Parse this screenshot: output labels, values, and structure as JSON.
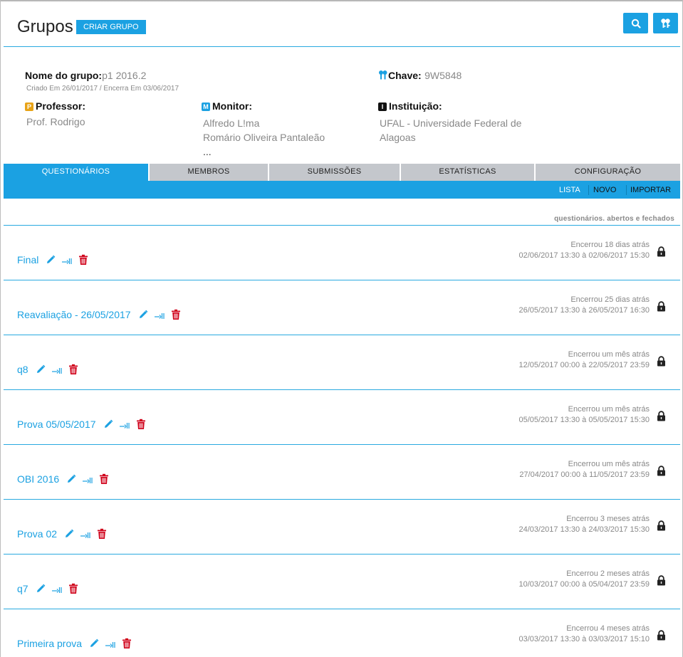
{
  "page": {
    "title": "Grupos",
    "create_button": "CRIAR GRUPO"
  },
  "header_icons": [
    "search-icon",
    "keys-icon"
  ],
  "group": {
    "name_label": "Nome do grupo:",
    "name": "p1 2016.2",
    "dates": "Criado Em 26/01/2017 / Encerra Em 03/06/2017",
    "key_label": "Chave:",
    "key": "9W5848",
    "professor_badge": "P",
    "professor_label": "Professor:",
    "professor": "Prof. Rodrigo",
    "monitor_badge": "M",
    "monitor_label": "Monitor:",
    "monitors": [
      "Alfredo L!ma",
      "Romário Oliveira Pantaleão",
      "..."
    ],
    "institution_badge": "I",
    "institution_label": "Instituição:",
    "institution_line1": "UFAL - Universidade Federal de",
    "institution_line2": "Alagoas"
  },
  "tabs": [
    "QUESTIONÁRIOS",
    "MEMBROS",
    "SUBMISSÕES",
    "ESTATÍSTICAS",
    "CONFIGURAÇÃO"
  ],
  "subnav": [
    "LISTA",
    "NOVO",
    "IMPORTAR"
  ],
  "filter_label": "questionários. abertos e fechados",
  "colors": {
    "accent": "#1ba1e2",
    "tab_inactive": "#c4c7cc",
    "delete": "#d0021b"
  },
  "questionnaires": [
    {
      "name": "Final",
      "status": "Encerrou 18 dias atrás",
      "range": "02/06/2017 13:30 à 02/06/2017 15:30"
    },
    {
      "name": "Reavaliação - 26/05/2017",
      "status": "Encerrou 25 dias atrás",
      "range": "26/05/2017 13:30 à 26/05/2017 16:30"
    },
    {
      "name": "q8",
      "status": "Encerrou um mês atrás",
      "range": "12/05/2017 00:00 à 22/05/2017 23:59"
    },
    {
      "name": "Prova 05/05/2017",
      "status": "Encerrou um mês atrás",
      "range": "05/05/2017 13:30 à 05/05/2017 15:30"
    },
    {
      "name": "OBI 2016",
      "status": "Encerrou um mês atrás",
      "range": "27/04/2017 00:00 à 11/05/2017 23:59"
    },
    {
      "name": "Prova 02",
      "status": "Encerrou 3 meses atrás",
      "range": "24/03/2017 13:30 à 24/03/2017 15:30"
    },
    {
      "name": "q7",
      "status": "Encerrou 2 meses atrás",
      "range": "10/03/2017 00:00 à 05/04/2017 23:59"
    },
    {
      "name": "Primeira prova",
      "status": "Encerrou 4 meses atrás",
      "range": "03/03/2017 13:30 à 03/03/2017 15:10"
    }
  ]
}
